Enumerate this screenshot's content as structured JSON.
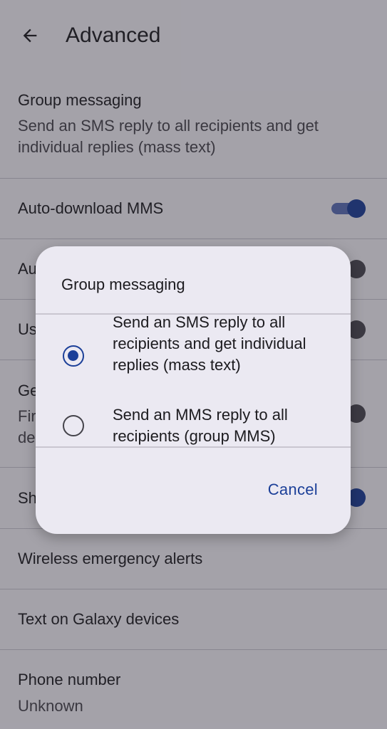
{
  "appbar": {
    "back_icon": "arrow-left-icon",
    "title": "Advanced"
  },
  "settings": {
    "group_messaging": {
      "title": "Group messaging",
      "subtitle": "Send an SMS reply to all recipients and get individual replies (mass text)"
    },
    "auto_download_mms": {
      "title": "Auto-download MMS",
      "enabled": true
    },
    "row3": {
      "title_visible": "Au",
      "enabled": false
    },
    "row4": {
      "title_visible": "Us",
      "enabled": false
    },
    "row5": {
      "title_visible": "Ge",
      "subtitle_line1_visible": "Fir",
      "subtitle_line2_visible": "de",
      "enabled": false
    },
    "row6": {
      "title_visible": "Sh",
      "enabled": true
    },
    "wireless_emergency_alerts": {
      "title": "Wireless emergency alerts"
    },
    "text_on_galaxy": {
      "title": "Text on Galaxy devices"
    },
    "phone_number": {
      "title": "Phone number",
      "value": "Unknown"
    }
  },
  "dialog": {
    "title": "Group messaging",
    "options": [
      {
        "label": "Send an SMS reply to all recipients and get individual replies (mass text)",
        "selected": true
      },
      {
        "label": "Send an MMS reply to all recipients (group MMS)",
        "selected": false
      }
    ],
    "cancel_label": "Cancel"
  },
  "colors": {
    "accent": "#1b3f98",
    "background": "#f7f5fb",
    "dialog_background": "#ebe9f2",
    "scrim": "rgba(40,38,48,0.40)"
  }
}
